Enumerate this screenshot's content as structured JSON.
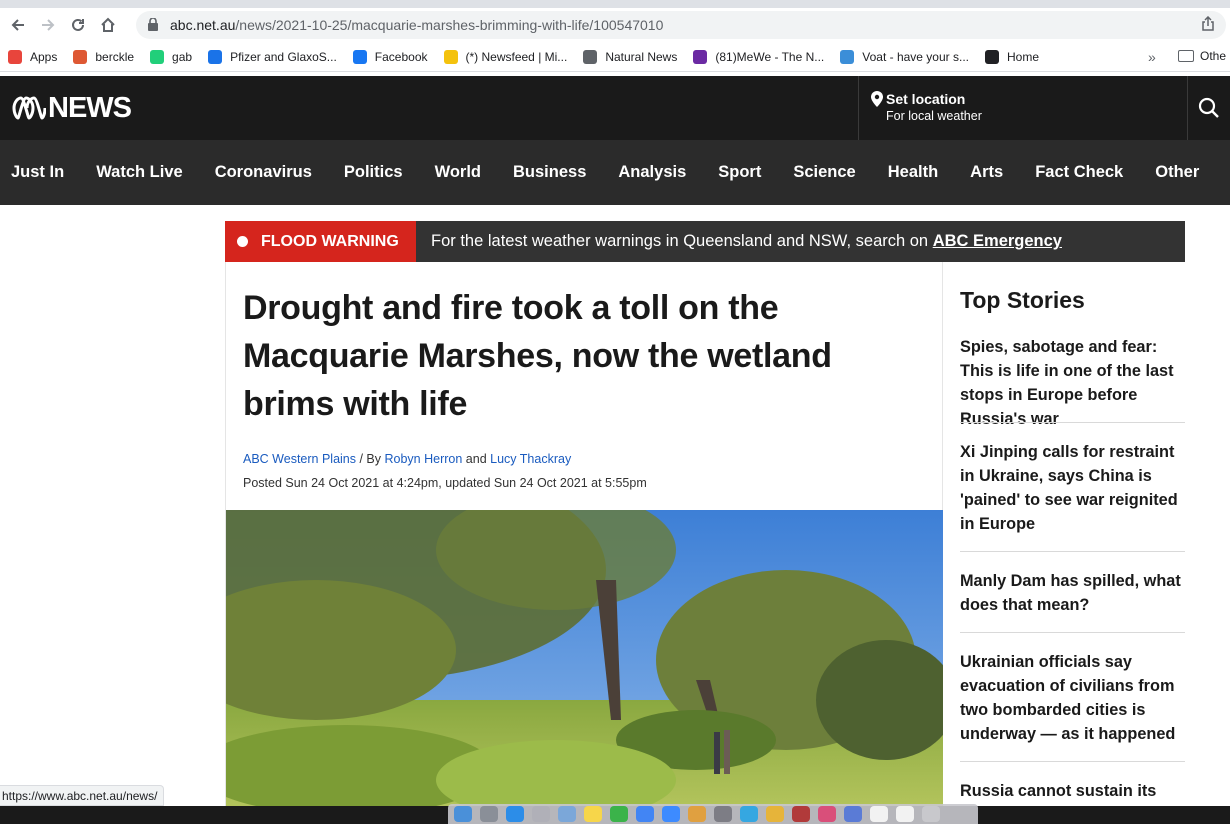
{
  "browser": {
    "url_host": "abc.net.au",
    "url_path": "/news/2021-10-25/macquarie-marshes-brimming-with-life/100547010",
    "bookmarks": [
      {
        "label": "Apps",
        "icon": "apps-grid-icon",
        "color": "#e8453c"
      },
      {
        "label": "berckle",
        "icon": "duckduckgo-icon",
        "color": "#de5833"
      },
      {
        "label": "gab",
        "icon": "gab-icon",
        "color": "#21cf7a"
      },
      {
        "label": "Pfizer and GlaxoS...",
        "icon": "globe-icon",
        "color": "#1a73e8"
      },
      {
        "label": "Facebook",
        "icon": "facebook-icon",
        "color": "#1877f2"
      },
      {
        "label": "(*) Newsfeed | Mi...",
        "icon": "lightbulb-icon",
        "color": "#f4c20d"
      },
      {
        "label": "Natural News",
        "icon": "globe-icon",
        "color": "#5f6368"
      },
      {
        "label": "(81)MeWe - The N...",
        "icon": "mewe-icon",
        "color": "#6b2aa3"
      },
      {
        "label": "Voat - have your s...",
        "icon": "voat-icon",
        "color": "#3b8ed8"
      },
      {
        "label": "Home",
        "icon": "home-logo-icon",
        "color": "#202124"
      }
    ],
    "overflow_label": "»",
    "other_bookmarks_label": "Othe",
    "status_url": "https://www.abc.net.au/news/"
  },
  "header": {
    "logo_text": "NEWS",
    "location_title": "Set location",
    "location_sub": "For local weather"
  },
  "nav": [
    "Just In",
    "Watch Live",
    "Coronavirus",
    "Politics",
    "World",
    "Business",
    "Analysis",
    "Sport",
    "Science",
    "Health",
    "Arts",
    "Fact Check",
    "Other"
  ],
  "flood": {
    "tag": "FLOOD WARNING",
    "message": "For the latest weather warnings in Queensland and NSW, search on ",
    "link": "ABC Emergency"
  },
  "article": {
    "headline": "Drought and fire took a toll on the Macquarie Marshes, now the wetland brims with life",
    "source": "ABC Western Plains",
    "by_sep": " / By ",
    "author1": "Robyn Herron",
    "and": " and ",
    "author2": "Lucy Thackray",
    "dates": "Posted Sun 24 Oct 2021 at 4:24pm, updated Sun 24 Oct 2021 at 5:55pm"
  },
  "sidebar": {
    "title": "Top Stories",
    "stories": [
      "Spies, sabotage and fear: This is life in one of the last stops in Europe before Russia's war",
      "Xi Jinping calls for restraint in Ukraine, says China is 'pained' to see war reignited in Europe",
      "Manly Dam has spilled, what does that mean?",
      "Ukrainian officials say evacuation of civilians from two bombarded cities is underway — as it happened",
      "Russia cannot sustain its"
    ]
  },
  "colors": {
    "abc_header": "#1a1a1a",
    "abc_nav": "#2b2b2b",
    "flood_red": "#d5251d",
    "link_blue": "#1a5bbf"
  }
}
